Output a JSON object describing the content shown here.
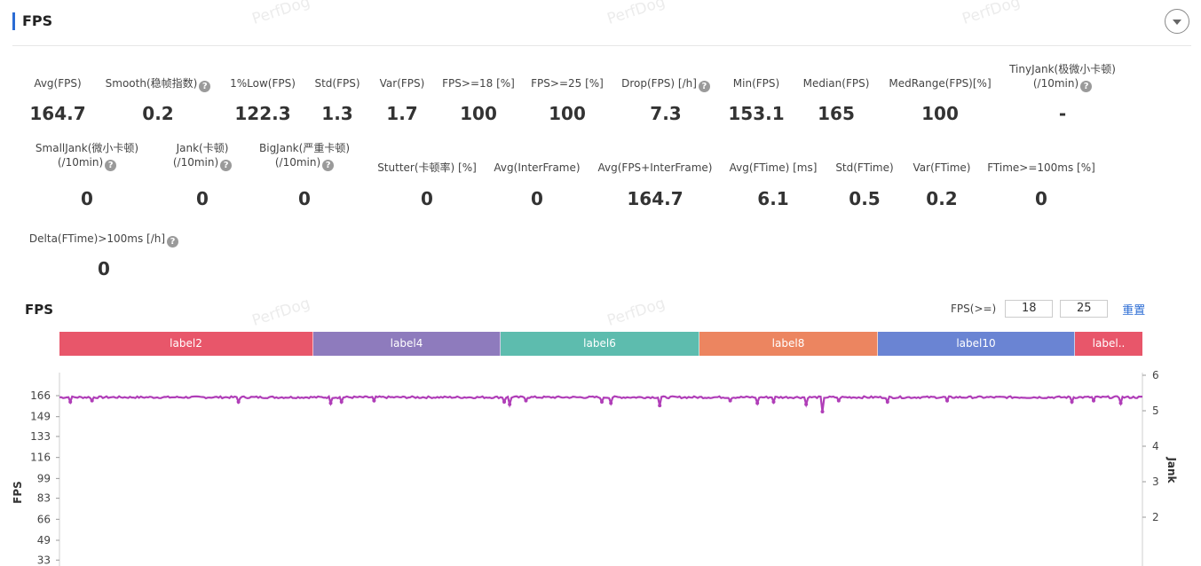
{
  "header": {
    "title": "FPS"
  },
  "watermark": "PerfDog",
  "metrics": [
    {
      "label": "Avg(FPS)",
      "value": "164.7",
      "help": false
    },
    {
      "label": "Smooth(稳帧指数)",
      "value": "0.2",
      "help": true
    },
    {
      "label": "1%Low(FPS)",
      "value": "122.3",
      "help": false
    },
    {
      "label": "Std(FPS)",
      "value": "1.3",
      "help": false
    },
    {
      "label": "Var(FPS)",
      "value": "1.7",
      "help": false
    },
    {
      "label": "FPS>=18 [%]",
      "value": "100",
      "help": false
    },
    {
      "label": "FPS>=25 [%]",
      "value": "100",
      "help": false
    },
    {
      "label": "Drop(FPS) [/h]",
      "value": "7.3",
      "help": true
    },
    {
      "label": "Min(FPS)",
      "value": "153.1",
      "help": false
    },
    {
      "label": "Median(FPS)",
      "value": "165",
      "help": false
    },
    {
      "label": "MedRange(FPS)[%]",
      "value": "100",
      "help": false
    },
    {
      "label": "TinyJank(极微小卡顿)",
      "label2": "(/10min)",
      "value": "-",
      "help": true
    },
    {
      "label": "SmallJank(微小卡顿)",
      "label2": "(/10min)",
      "value": "0",
      "help": true
    },
    {
      "label": "Jank(卡顿)",
      "label2": "(/10min)",
      "value": "0",
      "help": true
    },
    {
      "label": "BigJank(严重卡顿)",
      "label2": "(/10min)",
      "value": "0",
      "help": true
    },
    {
      "label": "Stutter(卡顿率) [%]",
      "value": "0",
      "help": false
    },
    {
      "label": "Avg(InterFrame)",
      "value": "0",
      "help": false
    },
    {
      "label": "Avg(FPS+InterFrame)",
      "value": "164.7",
      "help": false
    },
    {
      "label": "Avg(FTime) [ms]",
      "value": "6.1",
      "help": false
    },
    {
      "label": "Std(FTime)",
      "value": "0.5",
      "help": false
    },
    {
      "label": "Var(FTime)",
      "value": "0.2",
      "help": false
    },
    {
      "label": "FTime>=100ms [%]",
      "value": "0",
      "help": false
    },
    {
      "label": "Delta(FTime)>100ms [/h]",
      "value": "0",
      "help": true
    }
  ],
  "chart_section": {
    "title": "FPS",
    "filter_label": "FPS(>=)",
    "threshold_1": "18",
    "threshold_2": "25",
    "reset_label": "重置",
    "segments": [
      {
        "label": "label2",
        "color": "#e8566a"
      },
      {
        "label": "label4",
        "color": "#8e7bbd"
      },
      {
        "label": "label6",
        "color": "#5dbcae"
      },
      {
        "label": "label8",
        "color": "#ec8560"
      },
      {
        "label": "label10",
        "color": "#6a84d3"
      },
      {
        "label": "label..",
        "color": "#e8566a"
      }
    ]
  },
  "chart_data": {
    "type": "line",
    "ylabel": "FPS",
    "y2label": "Jank",
    "yticks": [
      "166",
      "149",
      "133",
      "116",
      "99",
      "83",
      "66",
      "49",
      "33"
    ],
    "y2ticks": [
      "6",
      "5",
      "4",
      "3",
      "2"
    ],
    "ylim": [
      16,
      166
    ],
    "y2lim": [
      1,
      6
    ],
    "series": [
      {
        "color": "#b03eb8",
        "baseline": 164.7,
        "min": 153.1,
        "dips": [
          {
            "x": 0.01,
            "y": 161
          },
          {
            "x": 0.03,
            "y": 162
          },
          {
            "x": 0.165,
            "y": 161
          },
          {
            "x": 0.25,
            "y": 160
          },
          {
            "x": 0.26,
            "y": 161
          },
          {
            "x": 0.29,
            "y": 162
          },
          {
            "x": 0.41,
            "y": 161
          },
          {
            "x": 0.415,
            "y": 159
          },
          {
            "x": 0.43,
            "y": 162
          },
          {
            "x": 0.5,
            "y": 161
          },
          {
            "x": 0.51,
            "y": 160
          },
          {
            "x": 0.555,
            "y": 158
          },
          {
            "x": 0.62,
            "y": 162
          },
          {
            "x": 0.645,
            "y": 160
          },
          {
            "x": 0.66,
            "y": 161
          },
          {
            "x": 0.69,
            "y": 159
          },
          {
            "x": 0.705,
            "y": 153.1
          },
          {
            "x": 0.72,
            "y": 162
          },
          {
            "x": 0.765,
            "y": 161
          },
          {
            "x": 0.82,
            "y": 162
          },
          {
            "x": 0.935,
            "y": 161
          },
          {
            "x": 0.955,
            "y": 162
          },
          {
            "x": 0.98,
            "y": 160
          }
        ]
      }
    ]
  }
}
